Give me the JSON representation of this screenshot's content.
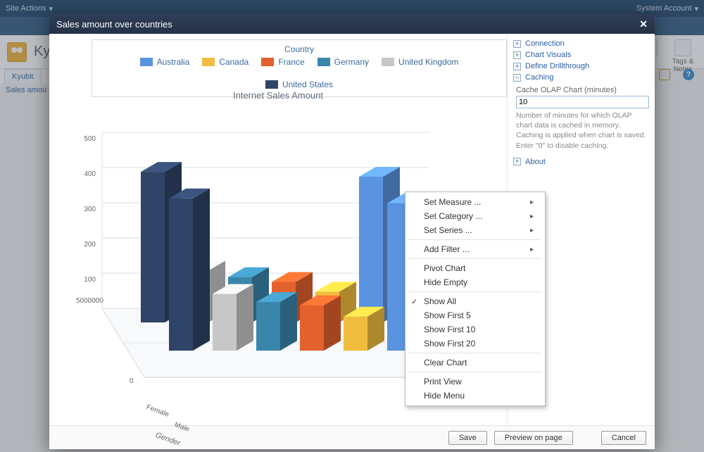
{
  "shell": {
    "site_actions": "Site Actions",
    "account": "System Account",
    "page_title": "Ky",
    "nav_tab": "Kyubit",
    "breadcrumb": "Sales amou",
    "tags_notes": "Tags &\nNotes"
  },
  "modal": {
    "title": "Sales amount over countries",
    "footer": {
      "save": "Save",
      "preview": "Preview on page",
      "cancel": "Cancel"
    }
  },
  "side": {
    "connection": "Connection",
    "chart_visuals": "Chart Visuals",
    "define_drillthrough": "Define Drillthrough",
    "caching": "Caching",
    "cache_label": "Cache OLAP Chart (minutes)",
    "cache_value": "10",
    "cache_help": "Number of minutes for which OLAP chart data is cached in memory. Caching is applied when chart is saved.\nEnter \"0\" to disable caching.",
    "about": "About"
  },
  "ctx": {
    "set_measure": "Set Measure ...",
    "set_category": "Set Category ...",
    "set_series": "Set Series ...",
    "add_filter": "Add Filter ...",
    "pivot_chart": "Pivot Chart",
    "hide_empty": "Hide Empty",
    "show_all": "Show All",
    "show_first_5": "Show First 5",
    "show_first_10": "Show First 10",
    "show_first_20": "Show First 20",
    "clear_chart": "Clear Chart",
    "print_view": "Print View",
    "hide_menu": "Hide Menu"
  },
  "legend": {
    "title": "Country",
    "items": [
      "Australia",
      "Canada",
      "France",
      "Germany",
      "United Kingdom",
      "United States"
    ],
    "colors": [
      "#5a93df",
      "#f1bd3f",
      "#e2612c",
      "#3a86ab",
      "#c7c7c7",
      "#2f4466"
    ]
  },
  "chart_title": "Internet Sales Amount",
  "axis": {
    "y_left": [
      "500",
      "400",
      "300",
      "200",
      "100"
    ],
    "y_right": {
      "max": "5000000",
      "zero": "0"
    },
    "category_axis_label": "Gender",
    "categories": [
      "Female",
      "Male"
    ]
  },
  "chart_data": {
    "type": "bar",
    "title": "Internet Sales Amount",
    "xlabel": "Gender",
    "ylabel": "",
    "ylim_front": [
      0,
      500
    ],
    "ylim_back": [
      0,
      5000000
    ],
    "categories": [
      "Female",
      "Male"
    ],
    "series": [
      {
        "name": "United States",
        "color": "#2f4466",
        "values": [
          4650000,
          4700000
        ]
      },
      {
        "name": "United Kingdom",
        "color": "#c7c7c7",
        "values": [
          1600000,
          1750000
        ]
      },
      {
        "name": "Germany",
        "color": "#3a86ab",
        "values": [
          1400000,
          1500000
        ]
      },
      {
        "name": "France",
        "color": "#e2612c",
        "values": [
          1250000,
          1400000
        ]
      },
      {
        "name": "Canada",
        "color": "#f1bd3f",
        "values": [
          950000,
          1050000
        ]
      },
      {
        "name": "Australia",
        "color": "#5a93df",
        "values": [
          4500000,
          4550000
        ]
      }
    ]
  }
}
